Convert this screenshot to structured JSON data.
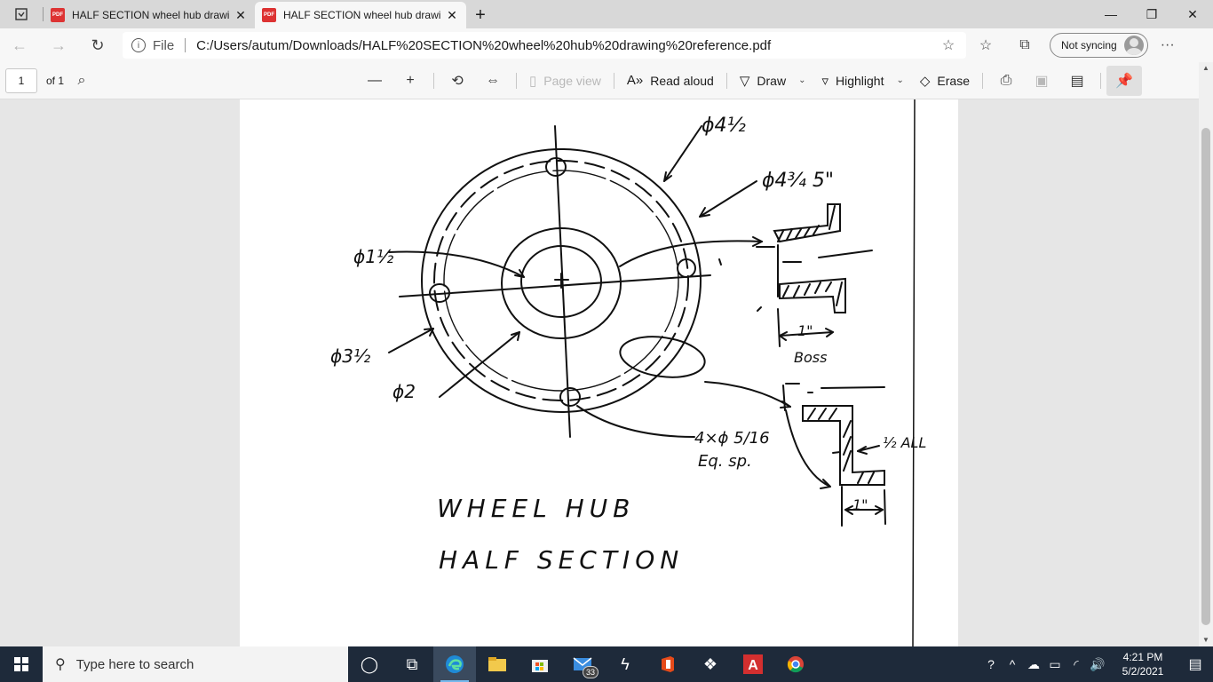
{
  "tabs": [
    {
      "title": "HALF SECTION wheel hub drawi",
      "active": false
    },
    {
      "title": "HALF SECTION wheel hub drawi",
      "active": true
    }
  ],
  "address": {
    "file_label": "File",
    "url": "C:/Users/autum/Downloads/HALF%20SECTION%20wheel%20hub%20drawing%20reference.pdf",
    "sync_label": "Not syncing"
  },
  "pdf_toolbar": {
    "page_number": "1",
    "page_total": "of 1",
    "page_view": "Page view",
    "read_aloud": "Read aloud",
    "draw": "Draw",
    "highlight": "Highlight",
    "erase": "Erase"
  },
  "drawing": {
    "dia_outer": "ϕ4½",
    "dia_hub_outer": "ϕ4¾ 5\"",
    "dia_bore": "ϕ1½",
    "dia_3_5": "ϕ3½",
    "dia_2": "ϕ2",
    "holes_line1": "4×ϕ 5/16",
    "holes_line2": "Eq. sp.",
    "boss_dim": "1\"",
    "boss_label": "Boss",
    "wall_note": "½ ALL",
    "bottom_dim": "1\"",
    "title_line1": "WHEEL HUB",
    "title_line2": "HALF SECTION"
  },
  "taskbar": {
    "search_placeholder": "Type here to search",
    "mail_badge": "33",
    "time": "4:21 PM",
    "date": "5/2/2021"
  }
}
